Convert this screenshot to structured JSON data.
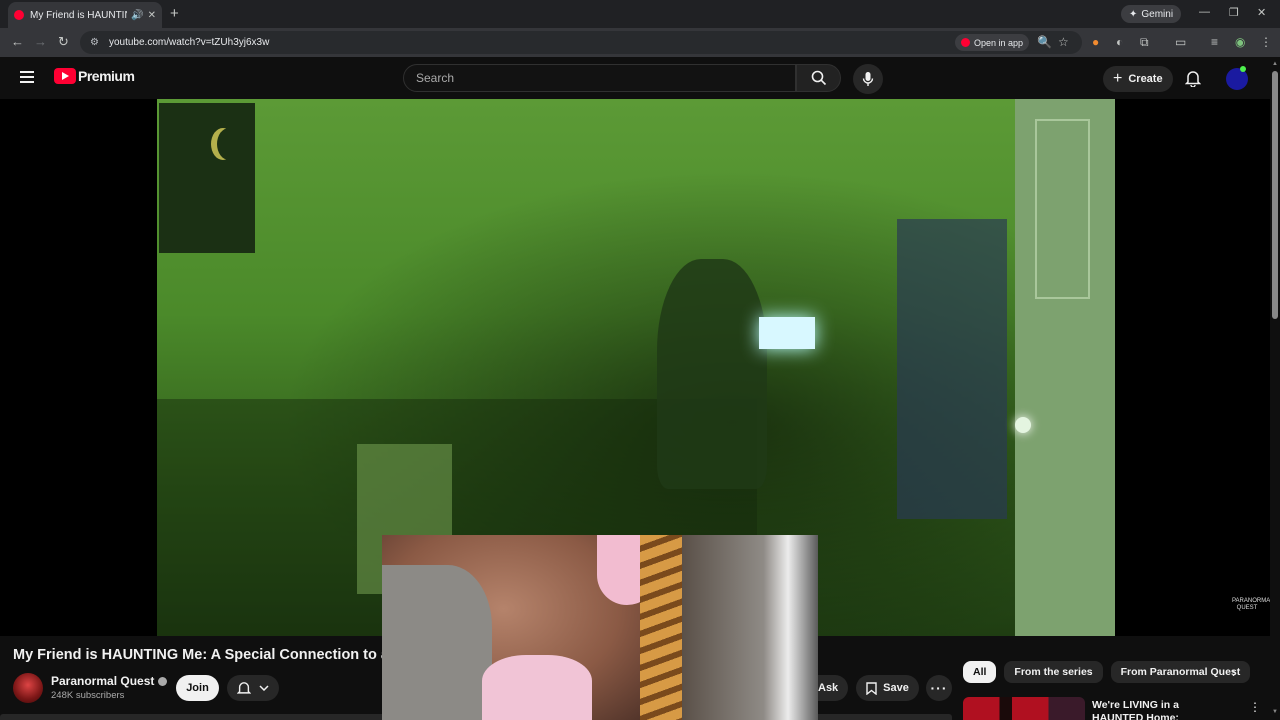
{
  "browser": {
    "tab_title": "My Friend is HAUNTING Me: A Special Connection to a Ghost",
    "new_tab": "+",
    "gemini_label": "Gemini",
    "url": "youtube.com/watch?v=tZUh3yj6x3w",
    "open_in_app": "Open in app"
  },
  "masthead": {
    "logo_text": "Premium",
    "search_placeholder": "Search",
    "create_label": "Create"
  },
  "video": {
    "title": "My Friend is HAUNTING Me: A Special Connection to a Ghost",
    "watermark": "PARANORMAL QUEST"
  },
  "channel": {
    "name": "Paranormal Quest",
    "subscribers": "248K subscribers",
    "join_label": "Join"
  },
  "actions": {
    "ask_label": "Ask",
    "save_label": "Save"
  },
  "chips": [
    "All",
    "From the series",
    "From Paranormal Quest"
  ],
  "recommendations": [
    {
      "title": "We're LIVING in a HAUNTED Home: Paranormal Activity"
    }
  ],
  "colors": {
    "youtube_red": "#ff0033",
    "background": "#0f0f0f",
    "chip_bg": "#272727"
  }
}
